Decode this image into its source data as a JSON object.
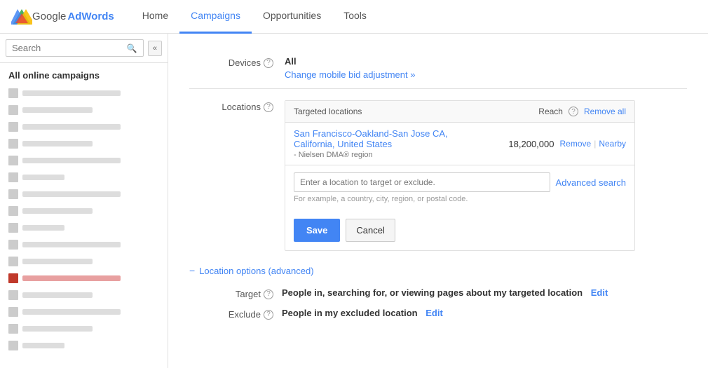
{
  "app": {
    "name": "Google AdWords"
  },
  "nav": {
    "items": [
      {
        "label": "Home",
        "active": false
      },
      {
        "label": "Campaigns",
        "active": true
      },
      {
        "label": "Opportunities",
        "active": false
      },
      {
        "label": "Tools",
        "active": false
      }
    ]
  },
  "sidebar": {
    "search_placeholder": "Search",
    "campaigns_title": "All online campaigns",
    "collapse_label": "«",
    "items": [
      {
        "id": 1,
        "width": "long",
        "highlighted": false
      },
      {
        "id": 2,
        "width": "medium",
        "highlighted": false
      },
      {
        "id": 3,
        "width": "long",
        "highlighted": false
      },
      {
        "id": 4,
        "width": "medium",
        "highlighted": false
      },
      {
        "id": 5,
        "width": "long",
        "highlighted": false
      },
      {
        "id": 6,
        "width": "short",
        "highlighted": false
      },
      {
        "id": 7,
        "width": "long",
        "highlighted": false
      },
      {
        "id": 8,
        "width": "medium",
        "highlighted": false
      },
      {
        "id": 9,
        "width": "short",
        "highlighted": false
      },
      {
        "id": 10,
        "width": "long",
        "highlighted": false
      },
      {
        "id": 11,
        "width": "medium",
        "highlighted": false
      },
      {
        "id": 12,
        "width": "long",
        "highlighted": true
      },
      {
        "id": 13,
        "width": "medium",
        "highlighted": false
      },
      {
        "id": 14,
        "width": "long",
        "highlighted": false
      },
      {
        "id": 15,
        "width": "medium",
        "highlighted": false
      },
      {
        "id": 16,
        "width": "short",
        "highlighted": false
      }
    ]
  },
  "devices": {
    "label": "Devices",
    "value": "All",
    "change_link": "Change mobile bid adjustment »"
  },
  "locations": {
    "label": "Locations",
    "panel": {
      "targeted_locations_label": "Targeted locations",
      "reach_label": "Reach",
      "remove_all_label": "Remove all",
      "location_name": "San Francisco-Oakland-San Jose CA, California, United States",
      "location_subtitle": "- Nielsen DMA® region",
      "reach_value": "18,200,000",
      "remove_label": "Remove",
      "nearby_label": "Nearby",
      "search_placeholder": "Enter a location to target or exclude.",
      "advanced_search_label": "Advanced search",
      "hint": "For example, a country, city, region, or postal code.",
      "save_label": "Save",
      "cancel_label": "Cancel"
    }
  },
  "location_options": {
    "toggle_label": "Location options (advanced)",
    "target_label": "Target",
    "target_value": "People in, searching for, or viewing pages about my targeted location",
    "target_edit": "Edit",
    "exclude_label": "Exclude",
    "exclude_value": "People in my excluded location",
    "exclude_edit": "Edit"
  }
}
